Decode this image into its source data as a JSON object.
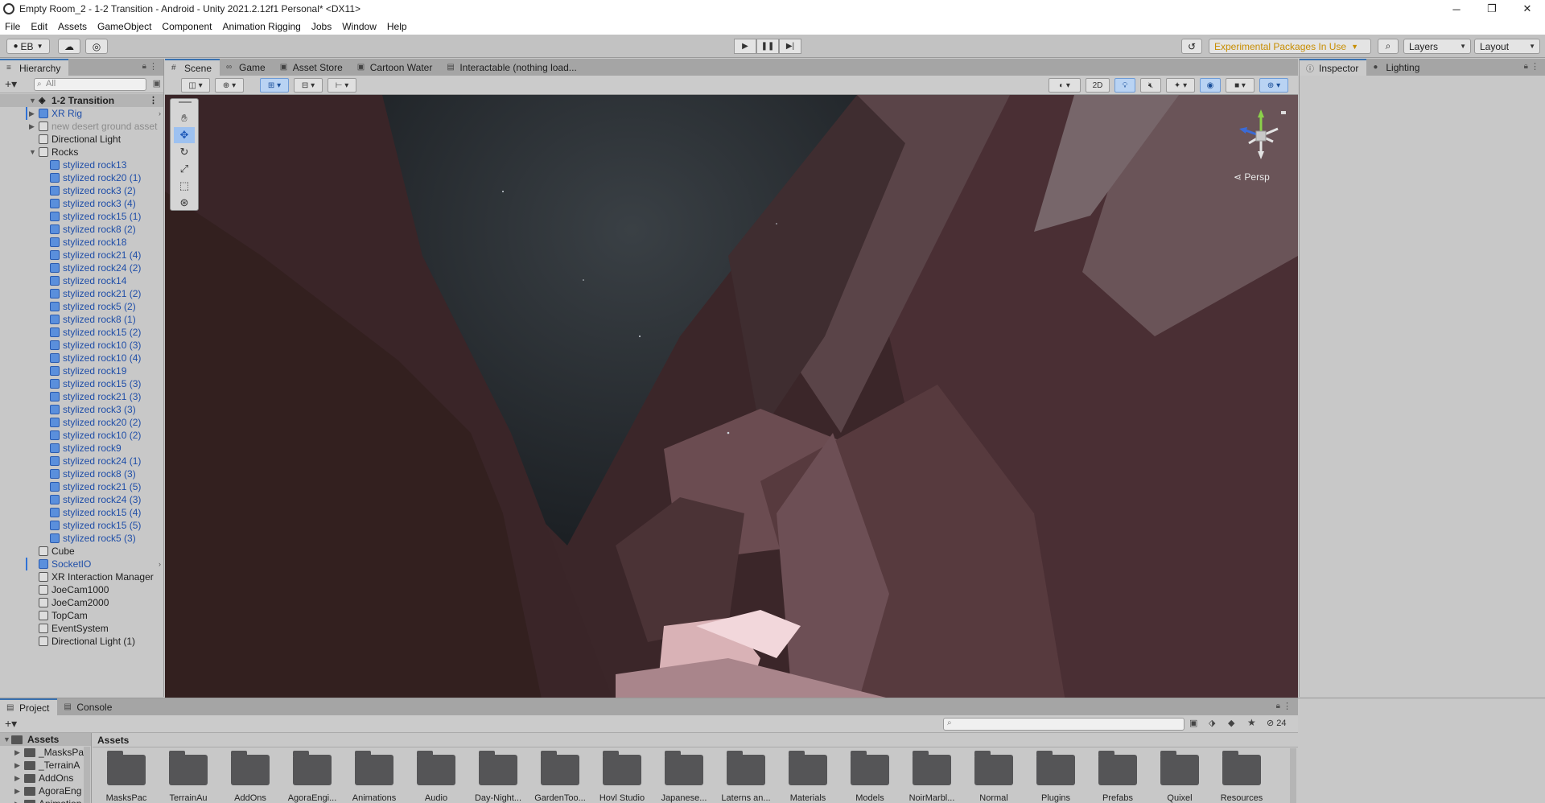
{
  "window": {
    "title": "Empty Room_2 - 1-2 Transition - Android - Unity 2021.2.12f1 Personal* <DX11>",
    "controls": [
      "─",
      "❐",
      "✕"
    ]
  },
  "menu": [
    "File",
    "Edit",
    "Assets",
    "GameObject",
    "Component",
    "Animation Rigging",
    "Jobs",
    "Window",
    "Help"
  ],
  "toolbar": {
    "account": "EB",
    "experimental": "Experimental Packages In Use",
    "layers": "Layers",
    "layout": "Layout"
  },
  "hierarchy": {
    "tab": "Hierarchy",
    "search_placeholder": "All",
    "scene": "1-2 Transition",
    "items": [
      {
        "label": "XR Rig",
        "level": 1,
        "color": "blue",
        "fold": "closed"
      },
      {
        "label": "new desert ground asset",
        "level": 1,
        "color": "gray",
        "fold": "closed"
      },
      {
        "label": "Directional Light",
        "level": 1,
        "color": "normal",
        "fold": ""
      },
      {
        "label": "Rocks",
        "level": 1,
        "color": "normal",
        "fold": "open"
      },
      {
        "label": "stylized rock13",
        "level": 2,
        "color": "blue"
      },
      {
        "label": "stylized rock20 (1)",
        "level": 2,
        "color": "blue"
      },
      {
        "label": "stylized rock3 (2)",
        "level": 2,
        "color": "blue"
      },
      {
        "label": "stylized rock3 (4)",
        "level": 2,
        "color": "blue"
      },
      {
        "label": "stylized rock15 (1)",
        "level": 2,
        "color": "blue"
      },
      {
        "label": "stylized rock8 (2)",
        "level": 2,
        "color": "blue"
      },
      {
        "label": "stylized rock18",
        "level": 2,
        "color": "blue"
      },
      {
        "label": "stylized rock21 (4)",
        "level": 2,
        "color": "blue"
      },
      {
        "label": "stylized rock24 (2)",
        "level": 2,
        "color": "blue"
      },
      {
        "label": "stylized rock14",
        "level": 2,
        "color": "blue"
      },
      {
        "label": "stylized rock21 (2)",
        "level": 2,
        "color": "blue"
      },
      {
        "label": "stylized rock5 (2)",
        "level": 2,
        "color": "blue"
      },
      {
        "label": "stylized rock8 (1)",
        "level": 2,
        "color": "blue"
      },
      {
        "label": "stylized rock15 (2)",
        "level": 2,
        "color": "blue"
      },
      {
        "label": "stylized rock10 (3)",
        "level": 2,
        "color": "blue"
      },
      {
        "label": "stylized rock10 (4)",
        "level": 2,
        "color": "blue"
      },
      {
        "label": "stylized rock19",
        "level": 2,
        "color": "blue"
      },
      {
        "label": "stylized rock15 (3)",
        "level": 2,
        "color": "blue"
      },
      {
        "label": "stylized rock21 (3)",
        "level": 2,
        "color": "blue"
      },
      {
        "label": "stylized rock3 (3)",
        "level": 2,
        "color": "blue"
      },
      {
        "label": "stylized rock20 (2)",
        "level": 2,
        "color": "blue"
      },
      {
        "label": "stylized rock10 (2)",
        "level": 2,
        "color": "blue"
      },
      {
        "label": "stylized rock9",
        "level": 2,
        "color": "blue"
      },
      {
        "label": "stylized rock24 (1)",
        "level": 2,
        "color": "blue"
      },
      {
        "label": "stylized rock8 (3)",
        "level": 2,
        "color": "blue"
      },
      {
        "label": "stylized rock21 (5)",
        "level": 2,
        "color": "blue"
      },
      {
        "label": "stylized rock24 (3)",
        "level": 2,
        "color": "blue"
      },
      {
        "label": "stylized rock15 (4)",
        "level": 2,
        "color": "blue"
      },
      {
        "label": "stylized rock15 (5)",
        "level": 2,
        "color": "blue"
      },
      {
        "label": "stylized rock5 (3)",
        "level": 2,
        "color": "blue"
      },
      {
        "label": "Cube",
        "level": 1,
        "color": "normal"
      },
      {
        "label": "SocketIO",
        "level": 1,
        "color": "blue"
      },
      {
        "label": "XR Interaction Manager",
        "level": 1,
        "color": "normal"
      },
      {
        "label": "JoeCam1000",
        "level": 1,
        "color": "normal"
      },
      {
        "label": "JoeCam2000",
        "level": 1,
        "color": "normal"
      },
      {
        "label": "TopCam",
        "level": 1,
        "color": "normal"
      },
      {
        "label": "EventSystem",
        "level": 1,
        "color": "normal"
      },
      {
        "label": "Directional Light (1)",
        "level": 1,
        "color": "normal"
      }
    ]
  },
  "scene_tabs": [
    {
      "label": "Scene",
      "icon": "#",
      "active": true
    },
    {
      "label": "Game",
      "icon": "∞",
      "active": false
    },
    {
      "label": "Asset Store",
      "icon": "▣",
      "active": false
    },
    {
      "label": "Cartoon Water",
      "icon": "▣",
      "active": false
    },
    {
      "label": "Interactable (nothing load...",
      "icon": "▤",
      "active": false
    }
  ],
  "scene": {
    "mode_2d": "2D",
    "persp": "Persp"
  },
  "inspector_tabs": [
    {
      "label": "Inspector",
      "icon": "ⓘ",
      "active": true
    },
    {
      "label": "Lighting",
      "icon": "●",
      "active": false
    }
  ],
  "project": {
    "tabs": [
      {
        "label": "Project",
        "icon": "▤",
        "active": true
      },
      {
        "label": "Console",
        "icon": "▤",
        "active": false
      }
    ],
    "hidden_count": "24",
    "tree_root": "Assets",
    "tree": [
      "_MasksPa",
      "_TerrainA",
      "AddOns",
      "AgoraEng",
      "Animation"
    ],
    "breadcrumb": "Assets",
    "folders": [
      "MasksPac",
      "TerrainAu",
      "AddOns",
      "AgoraEngi...",
      "Animations",
      "Audio",
      "Day-Night...",
      "GardenToo...",
      "Hovl Studio",
      "Japanese...",
      "Laterns an...",
      "Materials",
      "Models",
      "NoirMarbl...",
      "Normal",
      "Plugins",
      "Prefabs",
      "Quixel",
      "Resources"
    ]
  }
}
